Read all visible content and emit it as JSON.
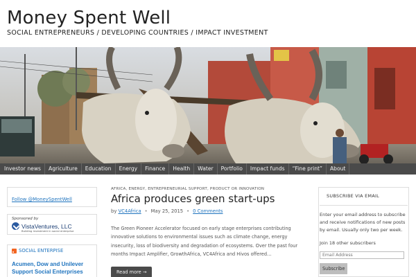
{
  "site": {
    "title": "Money Spent Well",
    "tagline": "SOCIAL ENTREPRENEURS / DEVELOPING COUNTRIES / IMPACT INVESTMENT"
  },
  "hero": {
    "alt": "Ox cart on street"
  },
  "nav": {
    "items": [
      "Investor news",
      "Agriculture",
      "Education",
      "Energy",
      "Finance",
      "Health",
      "Water",
      "Portfolio",
      "Impact funds",
      "“Fine print”",
      "About"
    ]
  },
  "left_sidebar": {
    "follow_link": "Follow @MoneySpentWell",
    "sponsor_label": "Sponsored by",
    "sponsor_name": "VistaVentures, LLC",
    "sponsor_sub": "Building investment in social enterprise",
    "social_enterprise_label": "SOCIAL ENTERPISE",
    "social_enterprise_post": "Acumen, Dow and Unilever Support Social Enterprises"
  },
  "post": {
    "categories": "AFRICA, ENERGY, ENTREPRENEURIAL SUPPORT, PRODUCT OR INNOVATION",
    "title": "Africa produces green start-ups",
    "by": "by",
    "author": "VC4Africa",
    "date": "May 25, 2015",
    "comments": "0 Comments",
    "excerpt": "The Green Pioneer Accelerator focused on early stage enterprises contributing innovative solutions to environmental issues such as climate change, energy insecurity, loss of biodiversity and degradation of ecosystems. Over the past four months Impact Amplifier, GrowthAfrica, VC4Africa and Hivos offered…",
    "read_more": "Read more →"
  },
  "subscribe": {
    "heading": "SUBSCRIBE VIA EMAIL",
    "text": "Enter your email address to subscribe and receive notifications of new posts by email. Usually only two per week.",
    "count": "Join 18 other subscribers",
    "placeholder": "Email Address",
    "button": "Subscribe"
  },
  "colors": {
    "nav_bg": "#4a4a4a",
    "link": "#1e73be",
    "rss": "#f26522"
  }
}
